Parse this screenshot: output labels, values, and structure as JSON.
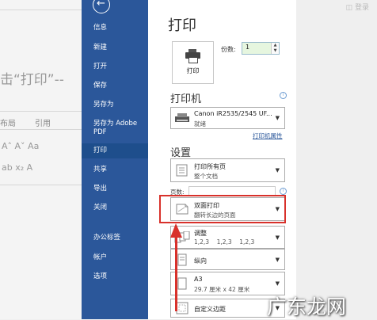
{
  "background_doc": {
    "text": "击“打印”--",
    "tab_layout": "布局",
    "tab_references": "引用",
    "font_row_1": "A˄ A˅ Aa",
    "font_row_2": "ab x₂ A"
  },
  "nav": {
    "back_glyph": "←",
    "items": [
      "信息",
      "新建",
      "打开",
      "保存",
      "另存为",
      "另存为 Adobe PDF",
      "打印",
      "共享",
      "导出",
      "关闭",
      "办公标签",
      "帐户",
      "选项"
    ],
    "active": "打印"
  },
  "print": {
    "title": "打印",
    "print_button": "打印",
    "copies_label": "份数:",
    "copies_value": "1"
  },
  "printer": {
    "heading": "打印机",
    "name": "Canon iR2535/2545 UF...",
    "status": "就绪",
    "properties_link": "打印机属性"
  },
  "settings": {
    "heading": "设置",
    "range_title": "打印所有页",
    "range_sub": "整个文档",
    "pages_label": "页数:",
    "pages_value": "",
    "duplex_title": "双面打印",
    "duplex_sub": "翻转长边的页面",
    "collate_title": "调整",
    "collate_sub": "1,2,3    1,2,3    1,2,3",
    "orientation": "纵向",
    "paper_title": "A3",
    "paper_sub": "29.7 厘米 x 42 厘米",
    "margins": "自定义边距"
  },
  "preview": {
    "ghost_text": "◫ 登录"
  },
  "watermark": "广东龙网",
  "colors": {
    "nav_bg": "#2b579a",
    "highlight": "#d8312b",
    "copies_bg": "#e6f6df"
  }
}
